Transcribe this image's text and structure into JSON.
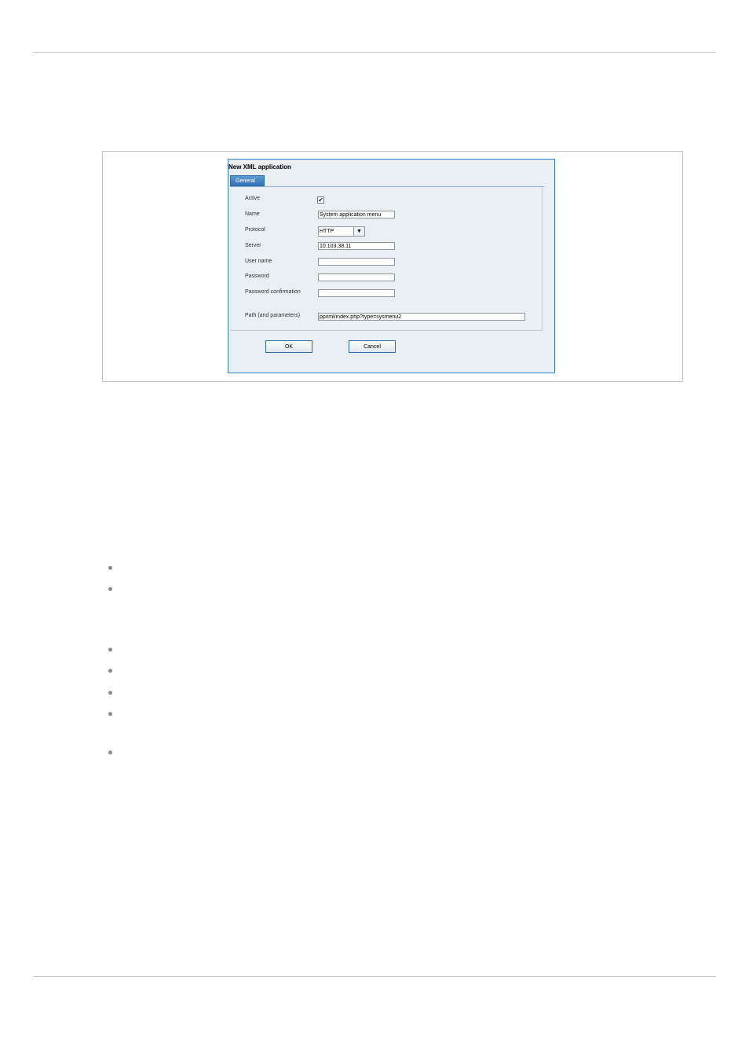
{
  "dialog": {
    "title": "New XML application",
    "tab_general": "General",
    "fields": {
      "active_label": "Active",
      "active_checked": true,
      "name_label": "Name",
      "name_value": "System application menu",
      "protocol_label": "Protocol",
      "protocol_value": "HTTP",
      "server_label": "Server",
      "server_value": "10.103.38.11",
      "username_label": "User name",
      "username_value": "",
      "password_label": "Password",
      "password_value": "",
      "password_confirmation_label": "Password confirmation",
      "password_confirmation_value": "",
      "path_label": "Path (and parameters)",
      "path_value": "ppxml/index.php?type=sysmenu2"
    },
    "ok_label": "OK",
    "cancel_label": "Cancel"
  },
  "icons": {
    "checkmark": "check-icon",
    "dropdown_arrow": "chevron-down-icon",
    "bullet": "bullet-icon"
  },
  "colors": {
    "dialog_border": "#3a7fc1",
    "tab_background": "#2f73b8",
    "dialog_background": "#e9eef3"
  }
}
